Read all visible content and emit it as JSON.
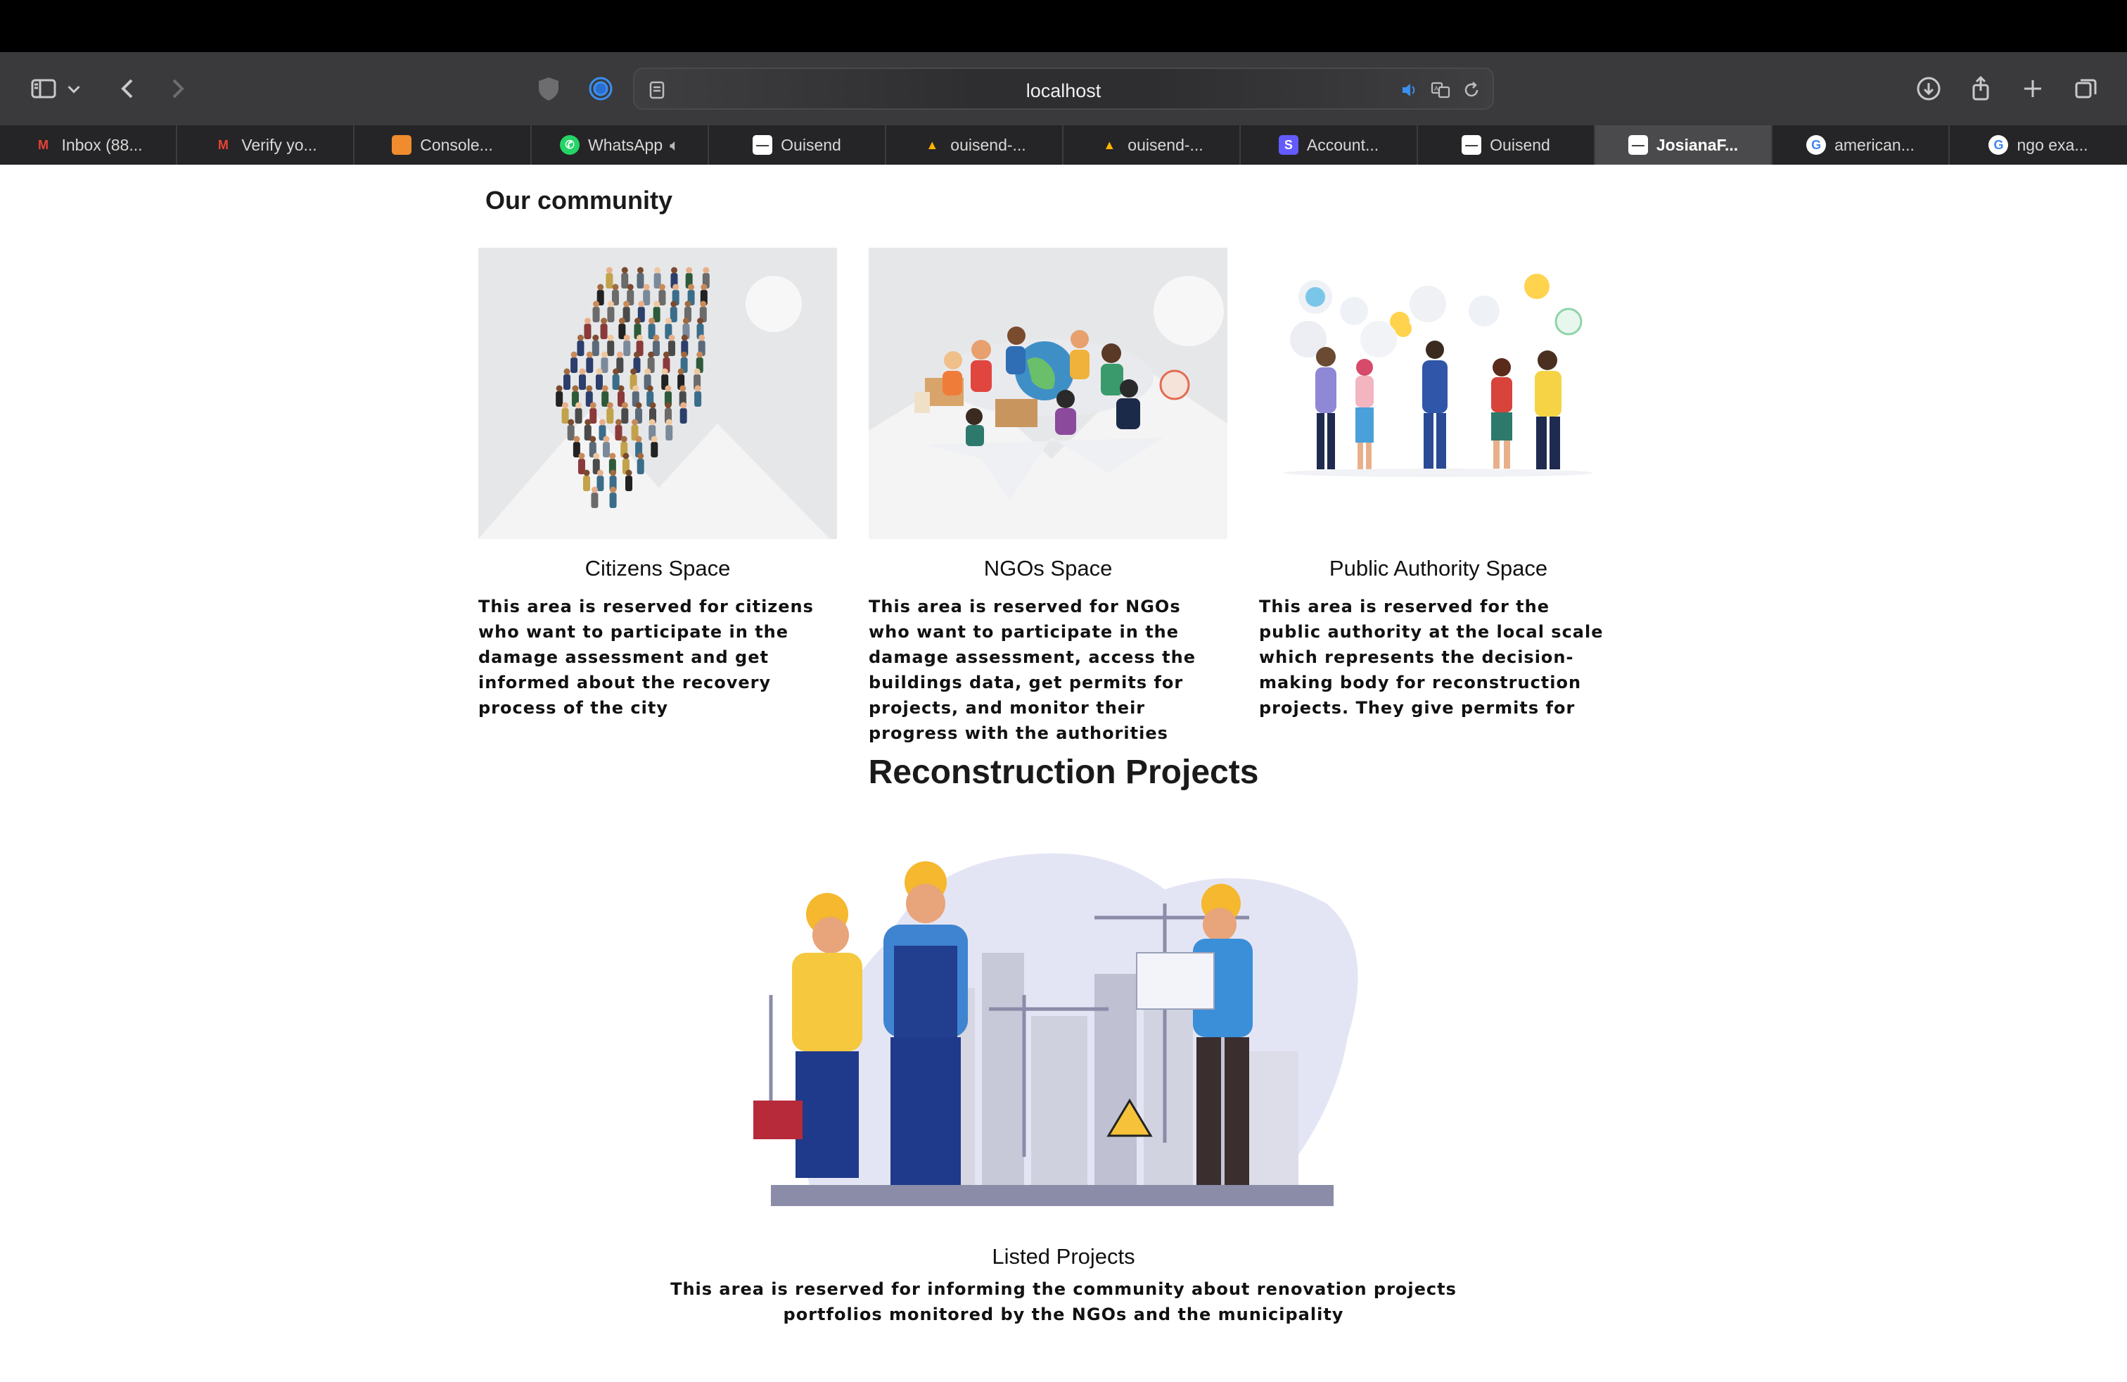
{
  "browser": {
    "url": "localhost",
    "tabs": [
      {
        "label": "Inbox (88...",
        "favicon": "gmail-icon",
        "color": "#ea4335",
        "glyph": "M"
      },
      {
        "label": "Verify yo...",
        "favicon": "gmail-icon",
        "color": "#ea4335",
        "glyph": "M"
      },
      {
        "label": "Console...",
        "favicon": "aws-cube-icon",
        "color": "#f08c2e",
        "glyph": "■"
      },
      {
        "label": "WhatsApp",
        "favicon": "whatsapp-icon",
        "color": "#25d366",
        "glyph": "☎"
      },
      {
        "label": "Ouisend",
        "favicon": "ouisend-icon",
        "color": "#ffffff",
        "glyph": "—"
      },
      {
        "label": "ouisend-...",
        "favicon": "firebase-icon",
        "color": "#ffb300",
        "glyph": "▲"
      },
      {
        "label": "ouisend-...",
        "favicon": "firebase-icon",
        "color": "#ffb300",
        "glyph": "▲"
      },
      {
        "label": "Account...",
        "favicon": "stripe-icon",
        "color": "#635bff",
        "glyph": "S"
      },
      {
        "label": "Ouisend",
        "favicon": "ouisend-icon",
        "color": "#ffffff",
        "glyph": "—"
      },
      {
        "label": "JosianaF...",
        "favicon": "ouisend-icon",
        "color": "#ffffff",
        "glyph": "—",
        "active": true
      },
      {
        "label": "american...",
        "favicon": "google-icon",
        "color": "#4285f4",
        "glyph": "G"
      },
      {
        "label": "ngo exa...",
        "favicon": "google-icon",
        "color": "#4285f4",
        "glyph": "G"
      }
    ]
  },
  "page": {
    "community_heading": "Our community",
    "cards": [
      {
        "title": "Citizens Space",
        "description": "This area is reserved for citizens who want to participate in the damage assessment and get informed about the recovery process of the city"
      },
      {
        "title": "NGOs Space",
        "description": "This area is reserved for NGOs who want to participate in the damage assessment, access the buildings data, get permits for projects, and monitor their progress with the authorities"
      },
      {
        "title": "Public Authority Space",
        "description": "This area is reserved for the public authority at the local scale which represents the decision-making body for reconstruction projects. They give permits for"
      }
    ],
    "recon_heading": "Reconstruction Projects",
    "listed_title": "Listed Projects",
    "listed_desc_line1": "This area is reserved for informing the community about renovation projects",
    "listed_desc_line2": "portfolios monitored by the NGOs and the municipality"
  }
}
